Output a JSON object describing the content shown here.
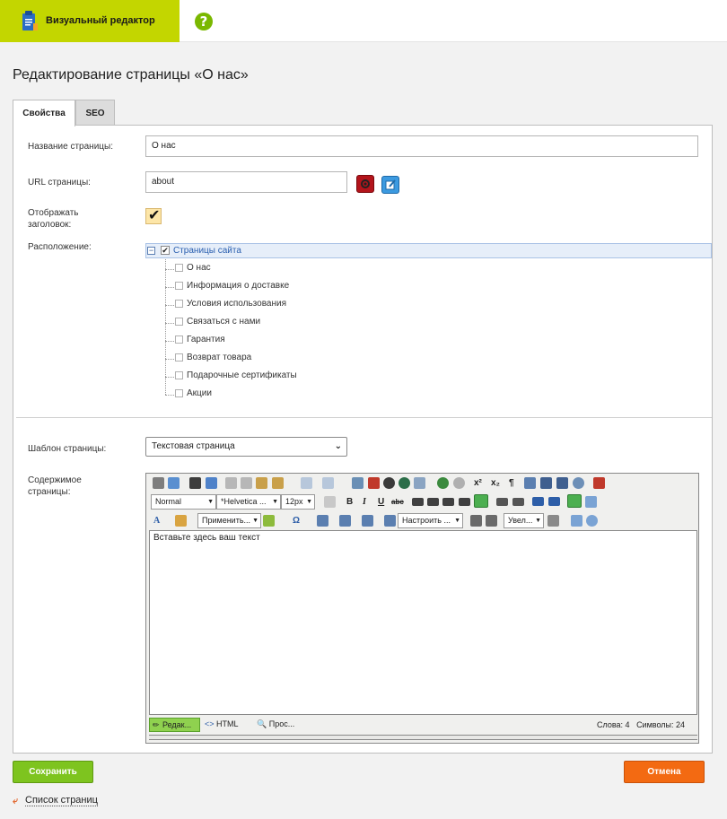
{
  "header": {
    "app_title": "Визуальный редактор",
    "help_icon": "?",
    "brand_color": "#c3d600"
  },
  "page": {
    "title": "Редактирование страницы «О нас»"
  },
  "tabs": [
    {
      "label": "Свойства",
      "active": true
    },
    {
      "label": "SEO",
      "active": false
    }
  ],
  "form": {
    "name_label": "Название страницы:",
    "name_value": "О нас",
    "url_label": "URL страницы:",
    "url_value": "about",
    "show_title_label_1": "Отображать",
    "show_title_label_2": "заголовок:",
    "show_title_checked": "✔",
    "location_label": "Расположение:",
    "template_label": "Шаблон страницы:",
    "template_value": "Текстовая страница",
    "content_label_1": "Содержимое",
    "content_label_2": "страницы:"
  },
  "tree": {
    "root": "Страницы сайта",
    "root_toggle": "−",
    "root_checked": "✔",
    "items": [
      "О нас",
      "Информация о доставке",
      "Условия использования",
      "Связаться с нами",
      "Гарантия",
      "Возврат товара",
      "Подарочные сертификаты",
      "Акции"
    ]
  },
  "editor": {
    "format_select": "Normal",
    "font_select": "*Helvetica ...",
    "size_select": "12px",
    "style_select": "Применить...",
    "tune_select": "Настроить ...",
    "zoom_select": "Увел...",
    "placeholder": "Вставьте здесь ваш текст",
    "mode_edit": "Редак...",
    "mode_html": "HTML",
    "mode_preview": "Прос...",
    "words": "Слова: 4",
    "chars": "Символы: 24",
    "bold": "B",
    "italic": "I",
    "underline": "U",
    "strike": "abc",
    "omega": "Ω",
    "font_color": "A",
    "sup": "x²",
    "sub": "x₂",
    "pilcrow": "¶"
  },
  "actions": {
    "save": "Сохранить",
    "cancel": "Отмена",
    "back": "Список страниц",
    "save_color": "#7ec41f",
    "cancel_color": "#f36a12"
  }
}
